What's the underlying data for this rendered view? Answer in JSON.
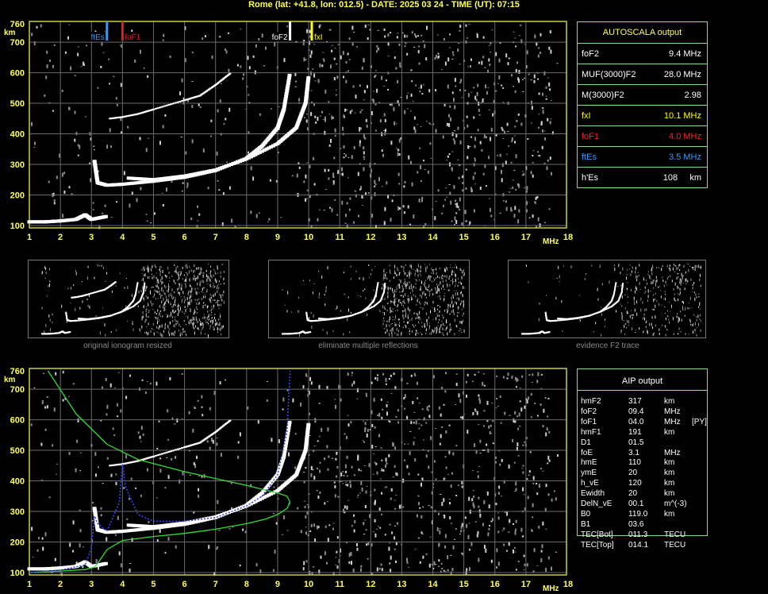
{
  "header": "Rome (lat: +41.8, lon: 012.5) - DATE: 2025 03 24 - TIME (UT): 07:15",
  "axis": {
    "y_ticks": [
      "760",
      "700",
      "600",
      "500",
      "400",
      "300",
      "200",
      "100"
    ],
    "y_unit": "km",
    "x_ticks": [
      "1",
      "2",
      "3",
      "4",
      "5",
      "6",
      "7",
      "8",
      "9",
      "10",
      "11",
      "12",
      "13",
      "14",
      "15",
      "16",
      "17",
      "18"
    ],
    "x_unit": "MHz"
  },
  "markers": {
    "ftEs": {
      "label": "ftEs",
      "freq": 3.5,
      "color": "#3399ff"
    },
    "foF1": {
      "label": "foF1",
      "freq": 4.0,
      "color": "#dd2222"
    },
    "foF2": {
      "label": "foF2",
      "freq": 9.4,
      "color": "#ffffff"
    },
    "fxI": {
      "label": "fxI",
      "freq": 10.1,
      "color": "#ffff00"
    }
  },
  "autoscala": {
    "title": "AUTOSCALA output",
    "rows": [
      {
        "key": "foF2",
        "value": "9.4 MHz",
        "color": "#ffffff"
      },
      {
        "key": "MUF(3000)F2",
        "value": "28.0 MHz",
        "color": "#ffffff"
      },
      {
        "key": "M(3000)F2",
        "value": "2.98",
        "color": "#ffffff"
      },
      {
        "key": "fxI",
        "value": "10.1 MHz",
        "color": "#ffff00"
      },
      {
        "key": "foF1",
        "value": "4.0 MHz",
        "color": "#ff2222"
      },
      {
        "key": "ftEs",
        "value": "3.5 MHz",
        "color": "#3399ff"
      },
      {
        "key": "h'Es",
        "value": "108     km",
        "color": "#ffffff"
      }
    ]
  },
  "thumbnails": [
    {
      "caption": "original ionogram resized"
    },
    {
      "caption": "eliminate multiple reflections"
    },
    {
      "caption": "evidence F2 trace"
    }
  ],
  "aip": {
    "title": "AIP output",
    "rows": [
      {
        "k": "hmF2",
        "v": "317",
        "u": "km",
        "x": ""
      },
      {
        "k": "foF2",
        "v": "09.4",
        "u": "MHz",
        "x": ""
      },
      {
        "k": "foF1",
        "v": "04.0",
        "u": "MHz",
        "x": "[PY]"
      },
      {
        "k": "hmF1",
        "v": "191",
        "u": "km",
        "x": ""
      },
      {
        "k": "D1",
        "v": "01.5",
        "u": "",
        "x": ""
      },
      {
        "k": "foE",
        "v": "3.1",
        "u": "MHz",
        "x": ""
      },
      {
        "k": "hmE",
        "v": "110",
        "u": "km",
        "x": ""
      },
      {
        "k": "ymE",
        "v": "20",
        "u": "km",
        "x": ""
      },
      {
        "k": "h_vE",
        "v": "120",
        "u": "km",
        "x": ""
      },
      {
        "k": "Ewidth",
        "v": "20",
        "u": "km",
        "x": ""
      },
      {
        "k": "DelN_vE",
        "v": "00.1",
        "u": "m^(-3)",
        "x": ""
      },
      {
        "k": "B0",
        "v": "119.0",
        "u": "km",
        "x": ""
      },
      {
        "k": "B1",
        "v": "03.6",
        "u": "",
        "x": ""
      },
      {
        "k": "TEC[Bot]",
        "v": "011.3",
        "u": "TECU",
        "x": ""
      },
      {
        "k": "TEC[Top]",
        "v": "014.1",
        "u": "TECU",
        "x": ""
      }
    ]
  },
  "chart_data": [
    {
      "type": "scatter",
      "title": "",
      "xlabel": "MHz",
      "ylabel": "km",
      "xlim": [
        1,
        18
      ],
      "ylim": [
        100,
        760
      ],
      "grid": true,
      "series": [
        {
          "name": "F trace O-mode",
          "x": [
            3.1,
            3.2,
            3.5,
            4,
            5,
            6,
            7,
            8,
            8.5,
            9,
            9.2,
            9.4
          ],
          "y": [
            310,
            240,
            232,
            235,
            245,
            258,
            280,
            320,
            360,
            420,
            480,
            600
          ]
        },
        {
          "name": "F trace X-mode",
          "x": [
            4.2,
            5,
            6,
            7,
            8,
            9,
            9.6,
            9.9,
            10.0
          ],
          "y": [
            255,
            250,
            262,
            282,
            318,
            368,
            420,
            500,
            590
          ]
        },
        {
          "name": "Es trace",
          "x": [
            1,
            1.5,
            2,
            2.5,
            2.8,
            3,
            3.5
          ],
          "y": [
            112,
            112,
            115,
            120,
            135,
            120,
            130
          ]
        },
        {
          "name": "multiple reflection",
          "x": [
            3.6,
            4,
            4.5,
            5,
            6,
            6.5,
            7,
            7.5
          ],
          "y": [
            450,
            455,
            465,
            480,
            510,
            525,
            560,
            600
          ]
        }
      ]
    },
    {
      "type": "line",
      "title": "",
      "xlabel": "MHz",
      "ylabel": "km",
      "xlim": [
        1,
        18
      ],
      "ylim": [
        100,
        760
      ],
      "grid": true,
      "series": [
        {
          "name": "electron density profile",
          "x": [
            1,
            2,
            2.8,
            3.1,
            3.2,
            3.5,
            4,
            5,
            6,
            7,
            8,
            8.6,
            9.0,
            9.3,
            9.4,
            9.3,
            9.0,
            8.0,
            6.0,
            4.5,
            3.5,
            2.5,
            1.6
          ],
          "y": [
            100,
            105,
            110,
            118,
            130,
            175,
            205,
            218,
            228,
            242,
            260,
            275,
            290,
            310,
            330,
            350,
            360,
            385,
            430,
            470,
            520,
            620,
            760
          ]
        },
        {
          "name": "virtual height profile",
          "x": [
            1,
            2,
            2.8,
            3.0,
            3.1,
            3.2,
            3.5,
            3.9,
            4.0,
            4.1,
            4.5,
            5,
            6,
            7,
            8,
            8.5,
            9.0,
            9.3,
            9.4
          ],
          "y": [
            100,
            108,
            125,
            180,
            285,
            260,
            235,
            330,
            455,
            380,
            290,
            268,
            268,
            280,
            318,
            350,
            420,
            560,
            760
          ]
        }
      ]
    }
  ]
}
